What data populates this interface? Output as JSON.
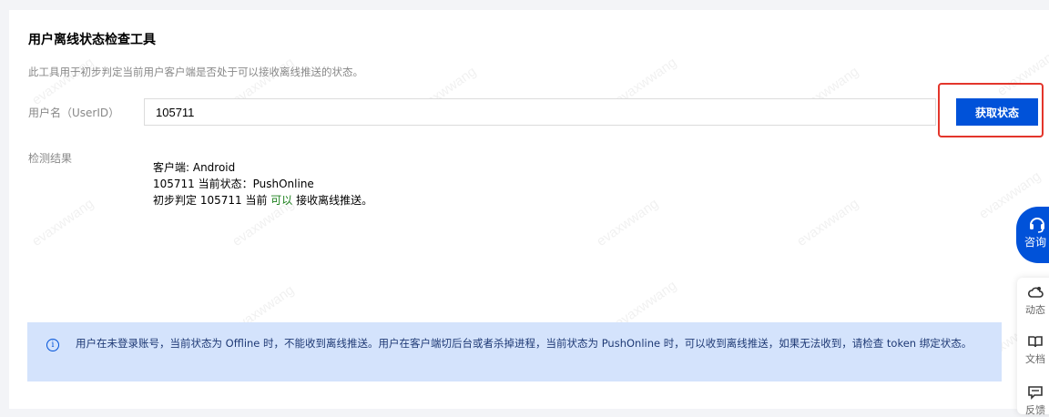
{
  "page": {
    "title": "用户离线状态检查工具",
    "description": "此工具用于初步判定当前用户客户端是否处于可以接收离线推送的状态。",
    "userid_label": "用户名（UserID）",
    "userid_value": "105711",
    "fetch_button": "获取状态",
    "result_label": "检测结果",
    "result": {
      "line1": "客户端: Android",
      "line2": "105711 当前状态：PushOnline",
      "line3_prefix": "初步判定 105711 当前 ",
      "line3_status": "可以",
      "line3_suffix": " 接收离线推送。"
    },
    "notice": "用户在未登录账号，当前状态为 Offline 时，不能收到离线推送。用户在客户端切后台或者杀掉进程，当前状态为 PushOnline 时，可以收到离线推送，如果无法收到，请检查 token 绑定状态。"
  },
  "float": {
    "consult_label": "咨询"
  },
  "sidebar_tools": [
    {
      "label": "动态",
      "icon": "cloud-icon"
    },
    {
      "label": "文档",
      "icon": "book-icon"
    },
    {
      "label": "反馈",
      "icon": "feedback-icon"
    }
  ],
  "watermark": "evaxwwang",
  "colors": {
    "primary": "#0052d9",
    "highlight": "#e3352b",
    "notice_bg": "#d4e3fc",
    "ok": "#1a7f1a"
  }
}
